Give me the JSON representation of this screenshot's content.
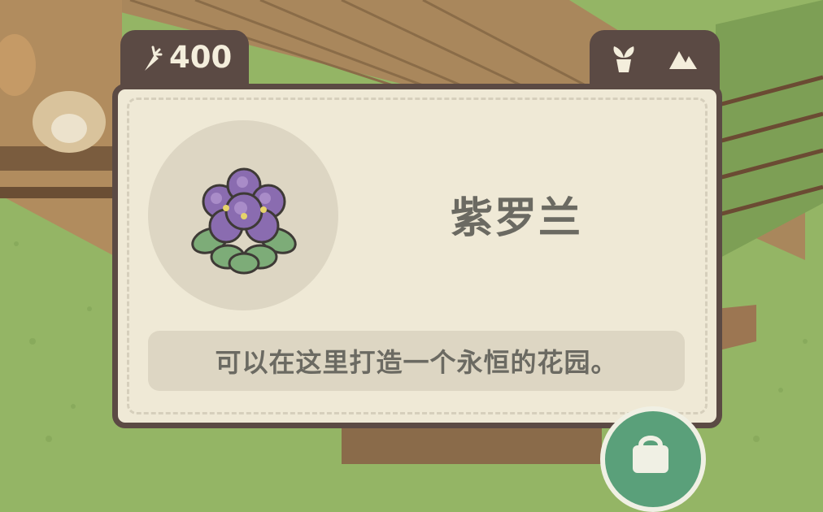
{
  "hud": {
    "carrot_icon": "carrot-icon",
    "carrot_count": "400",
    "right_icons": [
      "plant-pot-icon",
      "mountain-icon"
    ]
  },
  "item": {
    "name": "紫罗兰",
    "description": "可以在这里打造一个永恒的花园。",
    "image_icon": "violet-flower-icon"
  },
  "bag_button": {
    "icon": "bag-icon"
  },
  "colors": {
    "panel_border": "#5b4a44",
    "panel_bg": "#efe9d6",
    "text": "#6b6a62",
    "grass": "#94b565",
    "button_green": "#5aa07a"
  }
}
